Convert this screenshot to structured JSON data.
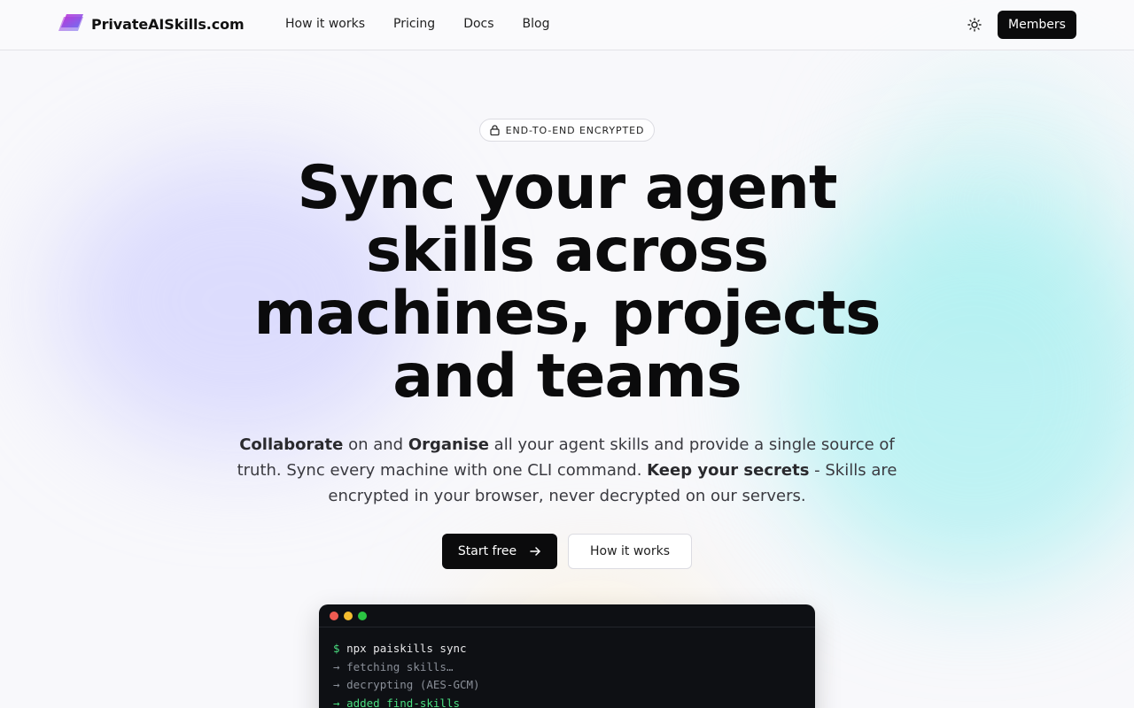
{
  "header": {
    "brand": "PrivateAISkills.com",
    "nav": [
      "How it works",
      "Pricing",
      "Docs",
      "Blog"
    ],
    "theme_icon": "sun-icon",
    "members_label": "Members"
  },
  "hero": {
    "badge": "END-TO-END ENCRYPTED",
    "badge_icon": "lock-icon",
    "title_lines": [
      "Sync your agent",
      "skills across",
      "machines, projects",
      "and teams"
    ],
    "subtitle": {
      "collaborate": "Collaborate",
      "t1": " on and ",
      "organise": "Organise",
      "t2": " all your agent skills and provide a single source of truth. Sync every machine with one CLI command. ",
      "keep": "Keep your secrets",
      "t3": " - Skills are encrypted in your browser, never decrypted on our servers."
    },
    "cta_primary": "Start free",
    "cta_primary_icon": "arrow-right-icon",
    "cta_secondary": "How it works"
  },
  "terminal": {
    "prompt": "$",
    "command": "npx paiskills sync",
    "lines": [
      {
        "arrow": "→",
        "text": "fetching skills…"
      },
      {
        "arrow": "→",
        "text": "decrypting (AES-GCM)"
      },
      {
        "arrow": "→",
        "text": "added find-skills"
      }
    ]
  },
  "colors": {
    "accent_dark": "#0b0b0c",
    "terminal_bg": "#0e1014",
    "terminal_green": "#4ade80",
    "logo_gradient": [
      "#a855f7",
      "#6366f1"
    ]
  }
}
